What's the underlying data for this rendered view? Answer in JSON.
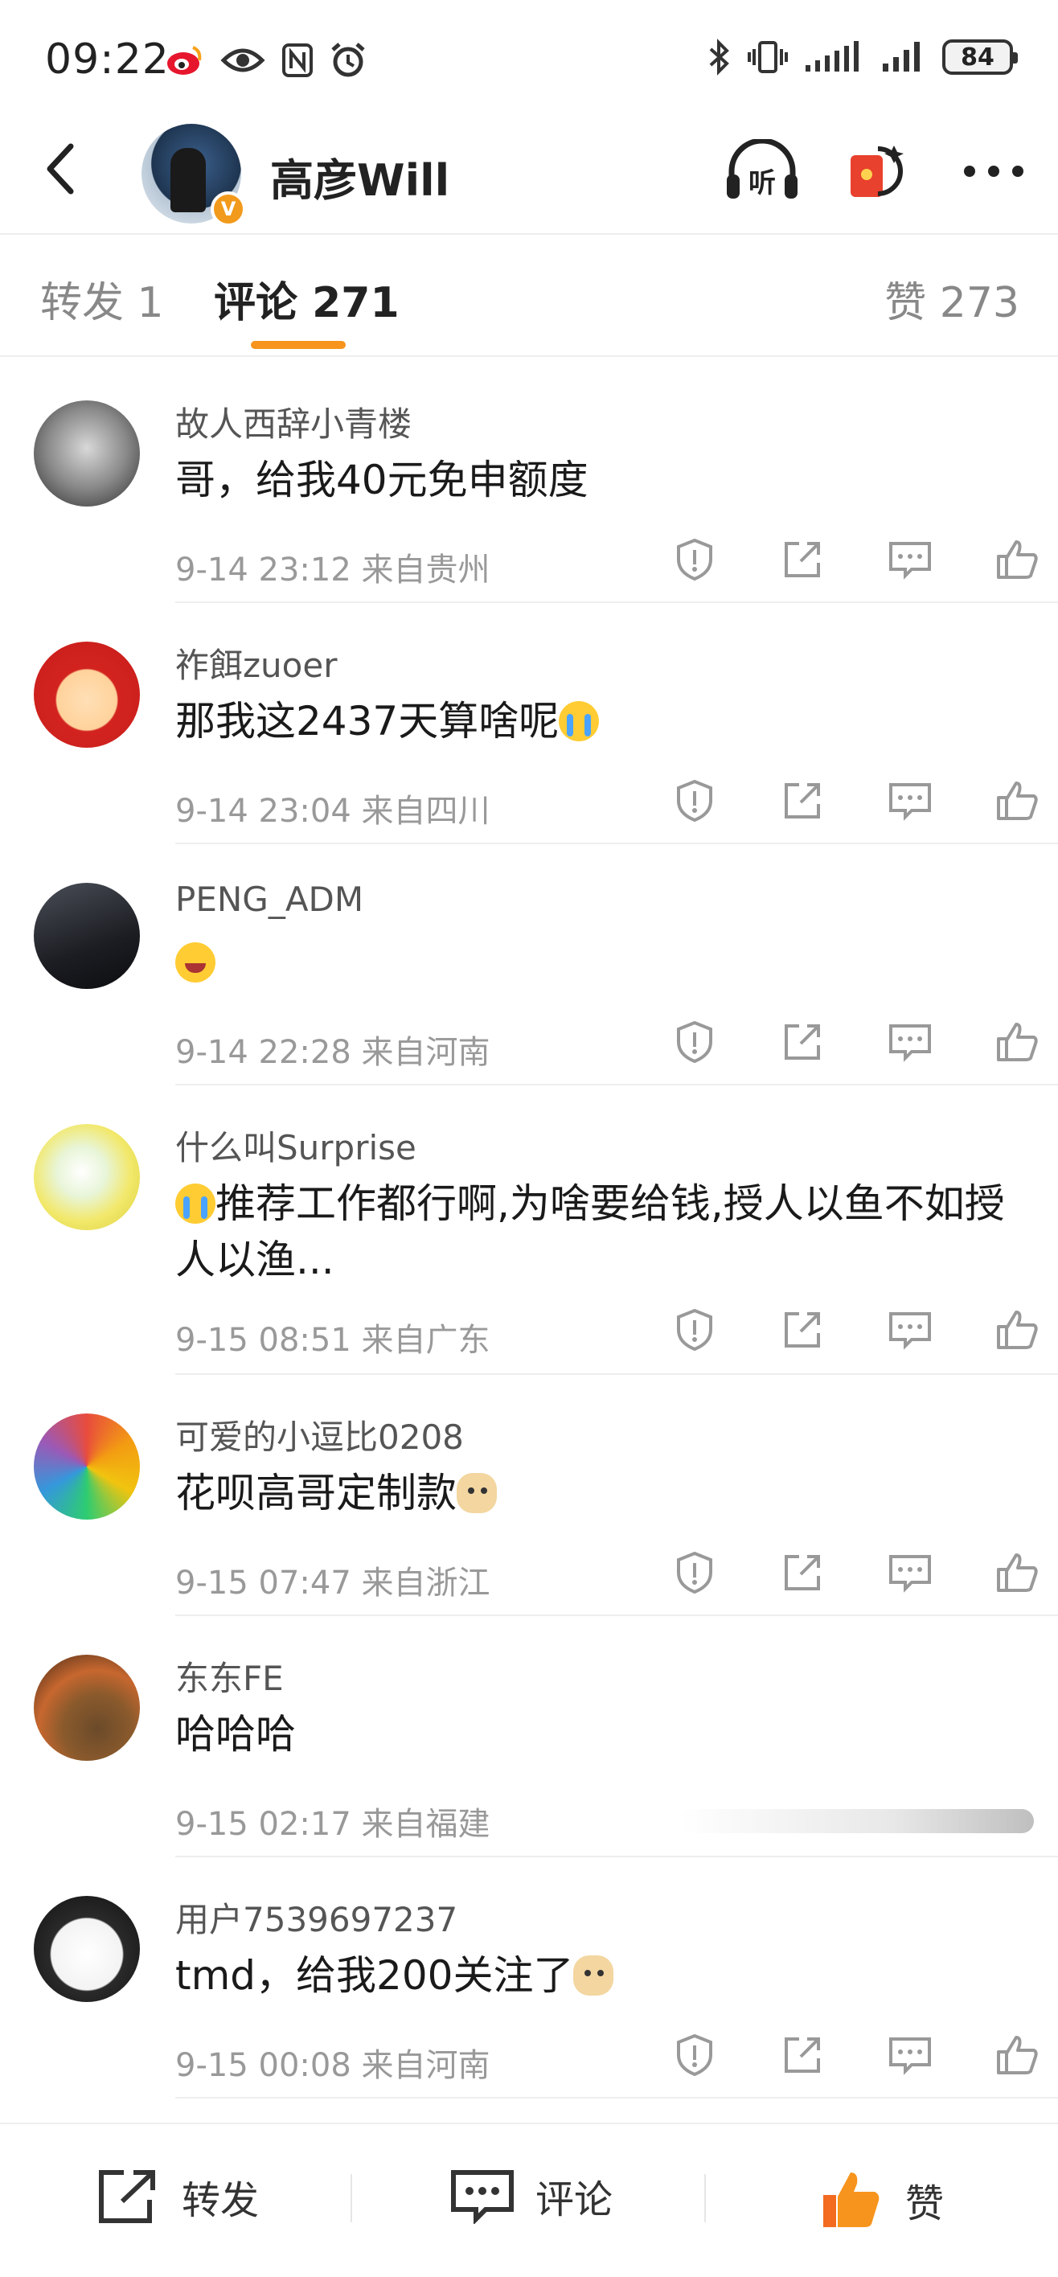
{
  "status_bar": {
    "time": "09:22",
    "battery": "84",
    "left_icons": [
      "weibo-icon",
      "eye-icon",
      "nfc-icon",
      "alarm-icon"
    ],
    "right_icons": [
      "bluetooth-icon",
      "vibrate-icon",
      "signal-icon",
      "signal-icon"
    ]
  },
  "header": {
    "name": "高彦Will",
    "verified_badge": "V",
    "actions": [
      "listen-icon",
      "red-packet-icon",
      "more-icon"
    ]
  },
  "tabs": {
    "repost": "转发 1",
    "comments": "评论 271",
    "likes": "赞 273",
    "active_color": "#f7941d"
  },
  "comments": [
    {
      "user": "故人西辞小青楼",
      "text": "哥，给我40元免申额度",
      "emoji": "",
      "meta": "9-14 23:12  来自贵州"
    },
    {
      "user": "祚餌zuoer",
      "text": "那我这2437天算啥呢",
      "emoji": "cry",
      "meta": "9-14 23:04  来自四川"
    },
    {
      "user": "PENG_ADM",
      "text": "",
      "emoji": "laugh",
      "meta": "9-14 22:28  来自河南"
    },
    {
      "user": "什么叫Surprise",
      "text": "推荐工作都行啊,为啥要给钱,授人以鱼不如授人以渔...",
      "emoji": "cry-prefix",
      "meta": "9-15 08:51  来自广东"
    },
    {
      "user": "可爱的小逗比0208",
      "text": "花呗高哥定制款",
      "emoji": "doge",
      "meta": "9-15 07:47  来自浙江"
    },
    {
      "user": "东东FE",
      "text": "哈哈哈",
      "emoji": "",
      "meta": "9-15 02:17  来自福建"
    },
    {
      "user": "用户7539697237",
      "text": "tmd，给我200关注了",
      "emoji": "doge",
      "meta": "9-15 00:08  来自河南"
    }
  ],
  "bottom_bar": {
    "repost": "转发",
    "comment": "评论",
    "like": "赞",
    "like_color": "#f26b21"
  }
}
